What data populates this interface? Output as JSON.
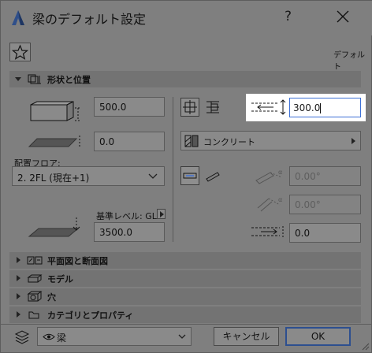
{
  "window": {
    "title": "梁のデフォルト設定",
    "help_label": "?",
    "close_label": "✕"
  },
  "header": {
    "favorite_icon": "star-icon",
    "default_label": "デフォルト"
  },
  "shape_section": {
    "title": "形状と位置",
    "height_value": "500.0",
    "offset_value": "0.0",
    "floor_label": "配置フロア:",
    "floor_value": "2. 2FL (現在+1)",
    "ref_level_label": "基準レベル: GL",
    "ref_level_value": "3500.0",
    "width_value": "300.0",
    "material_value": "コンクリート",
    "angle1_value": "0.00°",
    "angle2_value": "0.00°",
    "offset2_value": "0.0"
  },
  "sections": [
    {
      "label": "平面図と断面図"
    },
    {
      "label": "モデル"
    },
    {
      "label": "穴"
    },
    {
      "label": "カテゴリとプロパティ"
    }
  ],
  "footer": {
    "layer_value": "梁",
    "cancel_label": "キャンセル",
    "ok_label": "OK"
  },
  "colors": {
    "dim_background": "#7f7f7f",
    "highlight_field": "#ffffff",
    "accent": "#3b6fd6"
  }
}
